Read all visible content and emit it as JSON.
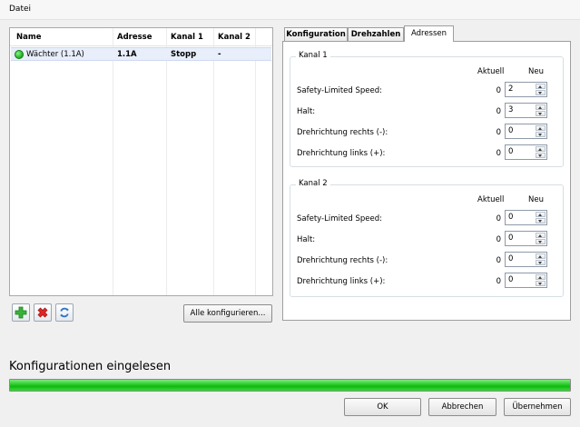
{
  "menu": {
    "file": "Datei"
  },
  "table": {
    "headers": [
      "Name",
      "Adresse",
      "Kanal 1",
      "Kanal 2"
    ],
    "rows": [
      {
        "name": "Wächter (1.1A)",
        "address": "1.1A",
        "kanal1": "Stopp",
        "kanal2": "-",
        "status_color": "#2fbf2f"
      }
    ]
  },
  "buttons": {
    "add_icon": "plus-icon",
    "delete_icon": "delete-icon",
    "refresh_icon": "refresh-icon",
    "configure_all": "Alle konfigurieren...",
    "ok": "OK",
    "cancel": "Abbrechen",
    "apply": "Übernehmen"
  },
  "tabs": [
    {
      "label": "Konfiguration",
      "active": false
    },
    {
      "label": "Drehzahlen",
      "active": false
    },
    {
      "label": "Adressen",
      "active": true
    }
  ],
  "groups": [
    {
      "title": "Kanal 1",
      "col_current": "Aktuell",
      "col_new": "Neu",
      "rows": [
        {
          "label": "Safety-Limited Speed:",
          "current": "0",
          "new": "2"
        },
        {
          "label": "Halt:",
          "current": "0",
          "new": "3"
        },
        {
          "label": "Drehrichtung rechts (-):",
          "current": "0",
          "new": "0"
        },
        {
          "label": "Drehrichtung links (+):",
          "current": "0",
          "new": "0"
        }
      ]
    },
    {
      "title": "Kanal 2",
      "col_current": "Aktuell",
      "col_new": "Neu",
      "rows": [
        {
          "label": "Safety-Limited Speed:",
          "current": "0",
          "new": "0"
        },
        {
          "label": "Halt:",
          "current": "0",
          "new": "0"
        },
        {
          "label": "Drehrichtung rechts (-):",
          "current": "0",
          "new": "0"
        },
        {
          "label": "Drehrichtung links (+):",
          "current": "0",
          "new": "0"
        }
      ]
    }
  ],
  "status": {
    "text": "Konfigurationen eingelesen",
    "progress_percent": 100,
    "progress_color": "#22c822"
  }
}
